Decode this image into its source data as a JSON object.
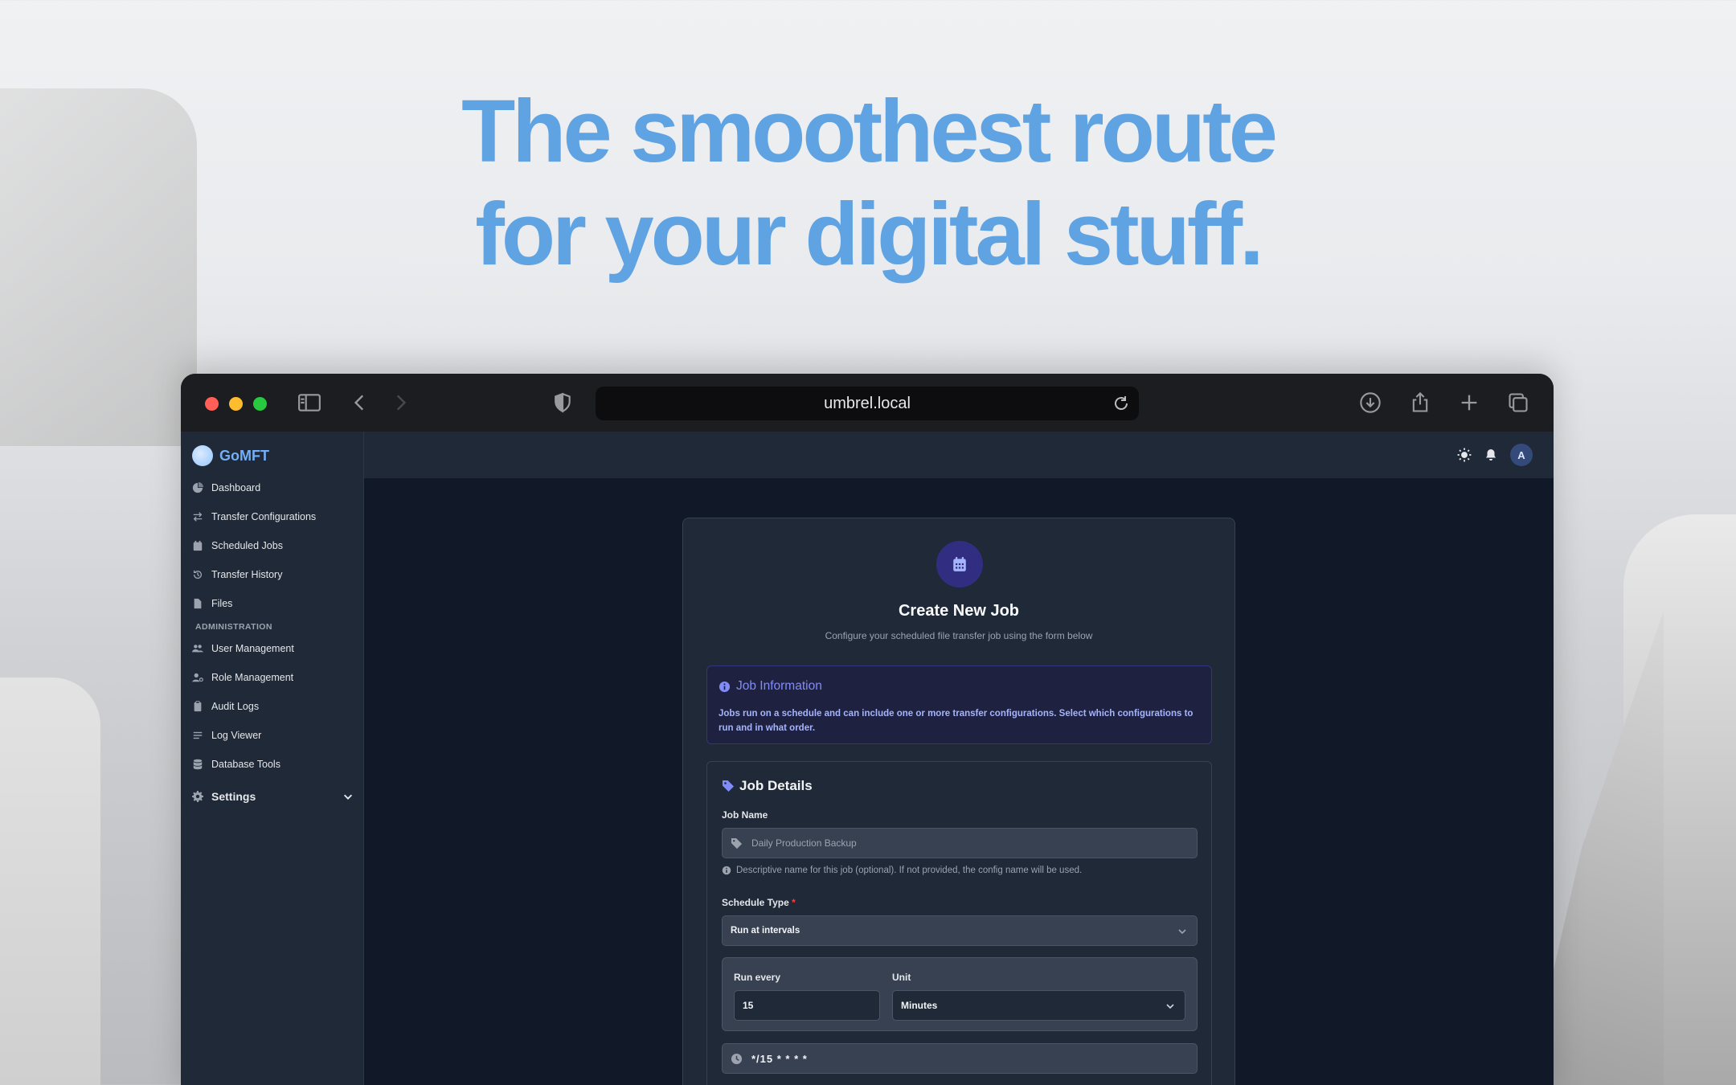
{
  "hero": {
    "line1": "The smoothest route",
    "line2": "for your digital stuff."
  },
  "browser": {
    "url": "umbrel.local",
    "icons": [
      "sidebar-toggle-icon",
      "back-icon",
      "forward-icon",
      "shield-icon",
      "reload-icon",
      "download-icon",
      "share-icon",
      "plus-icon",
      "tabs-icon"
    ]
  },
  "sidebar": {
    "brand": "GoMFT",
    "items": [
      {
        "label": "Dashboard",
        "icon": "dashboard-icon"
      },
      {
        "label": "Transfer Configurations",
        "icon": "transfer-icon"
      },
      {
        "label": "Scheduled Jobs",
        "icon": "calendar-icon"
      },
      {
        "label": "Transfer History",
        "icon": "history-icon"
      },
      {
        "label": "Files",
        "icon": "file-icon"
      }
    ],
    "admin_section": "ADMINISTRATION",
    "admin_items": [
      {
        "label": "User Management",
        "icon": "users-icon"
      },
      {
        "label": "Role Management",
        "icon": "user-cog-icon"
      },
      {
        "label": "Audit Logs",
        "icon": "clipboard-icon"
      },
      {
        "label": "Log Viewer",
        "icon": "list-icon"
      },
      {
        "label": "Database Tools",
        "icon": "database-icon"
      }
    ],
    "settings": "Settings"
  },
  "topbar": {
    "avatar": "A"
  },
  "form": {
    "title": "Create New Job",
    "subtitle": "Configure your scheduled file transfer job using the form below",
    "info_title": "Job Information",
    "info_body": "Jobs run on a schedule and can include one or more transfer configurations. Select which configurations to run and in what order.",
    "details_title": "Job Details",
    "job_name_label": "Job Name",
    "job_name_placeholder": "Daily Production Backup",
    "job_name_hint": "Descriptive name for this job (optional). If not provided, the config name will be used.",
    "schedule_type_label": "Schedule Type",
    "schedule_type_required": "*",
    "schedule_type_value": "Run at intervals",
    "run_every_label": "Run every",
    "run_every_value": "15",
    "unit_label": "Unit",
    "unit_value": "Minutes",
    "cron_value": "*/15 * * * *"
  },
  "colors": {
    "hero": "#5fa3e3",
    "accent": "#818cf8",
    "sidebar_bg": "#1f2937",
    "main_bg": "#111827"
  }
}
